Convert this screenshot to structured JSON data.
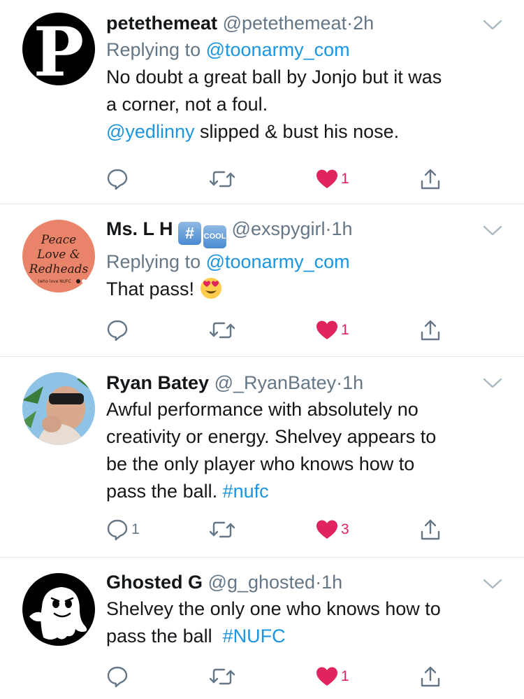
{
  "tweets": [
    {
      "name": "petethemeat",
      "handle": "@petethemeat",
      "time": "2h",
      "reply_prefix": "Replying to",
      "reply_to": "@toonarmy_com",
      "avatar_letter": "P",
      "lines": [
        "No doubt a great ball by Jonjo but it was",
        "a corner, not a foul."
      ],
      "mention": "@yedlinny",
      "mention_rest": " slipped & bust his nose.",
      "replies": "",
      "likes": "1"
    },
    {
      "name": "Ms. L H",
      "badge1": "#",
      "badge2": "COOL",
      "handle": "@exspygirl",
      "time": "1h",
      "reply_prefix": "Replying to",
      "reply_to": "@toonarmy_com",
      "avatar_text": [
        "Peace",
        "Love &",
        "Redheads",
        "(who love NUFC"
      ],
      "text": "That pass!",
      "replies": "",
      "likes": "1"
    },
    {
      "name": "Ryan Batey",
      "handle": "@_RyanBatey",
      "time": "1h",
      "lines": [
        "Awful performance with absolutely no",
        "creativity or energy. Shelvey appears to",
        "be the only player who knows how to"
      ],
      "last_line": "pass the ball. ",
      "hashtag": "#nufc",
      "replies": "1",
      "likes": "3"
    },
    {
      "name": "Ghosted G",
      "handle": "@g_ghosted",
      "time": "1h",
      "lines": [
        "Shelvey the only one who knows how to"
      ],
      "last_line": "pass the ball  ",
      "hashtag": "#NUFC",
      "replies": "",
      "likes": "1"
    }
  ],
  "separator": "·",
  "colors": {
    "text": "#14171a",
    "muted": "#657786",
    "link": "#1b95e0",
    "like": "#e0245e",
    "border": "#e1e8ed"
  },
  "icons": [
    "reply-icon",
    "retweet-icon",
    "heart-icon",
    "share-icon",
    "chevron-down-icon"
  ]
}
